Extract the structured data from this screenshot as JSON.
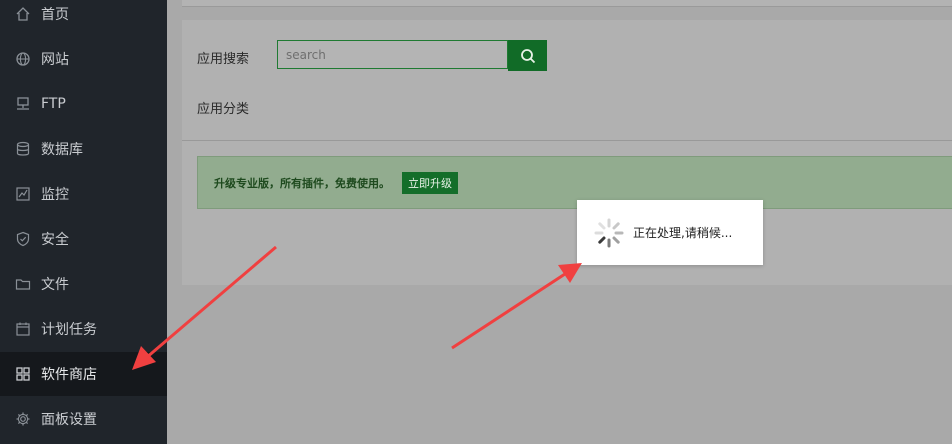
{
  "sidebar": {
    "items": [
      {
        "label": "首页",
        "icon": "home-icon"
      },
      {
        "label": "网站",
        "icon": "globe-icon"
      },
      {
        "label": "FTP",
        "icon": "ftp-icon"
      },
      {
        "label": "数据库",
        "icon": "database-icon"
      },
      {
        "label": "监控",
        "icon": "monitor-icon"
      },
      {
        "label": "安全",
        "icon": "shield-icon"
      },
      {
        "label": "文件",
        "icon": "folder-icon"
      },
      {
        "label": "计划任务",
        "icon": "calendar-icon"
      },
      {
        "label": "软件商店",
        "icon": "grid-icon",
        "active": true
      },
      {
        "label": "面板设置",
        "icon": "gear-icon"
      }
    ]
  },
  "main": {
    "search_label": "应用搜索",
    "search_placeholder": "search",
    "category_label": "应用分类",
    "notice_text": "升级专业版，所有插件，免费使用。",
    "upgrade_button": "立即升级"
  },
  "loading": {
    "text": "正在处理,请稍候..."
  },
  "colors": {
    "sidebar_bg": "#20252b",
    "accent_green": "#116b27",
    "annotation_red": "#f04040"
  }
}
